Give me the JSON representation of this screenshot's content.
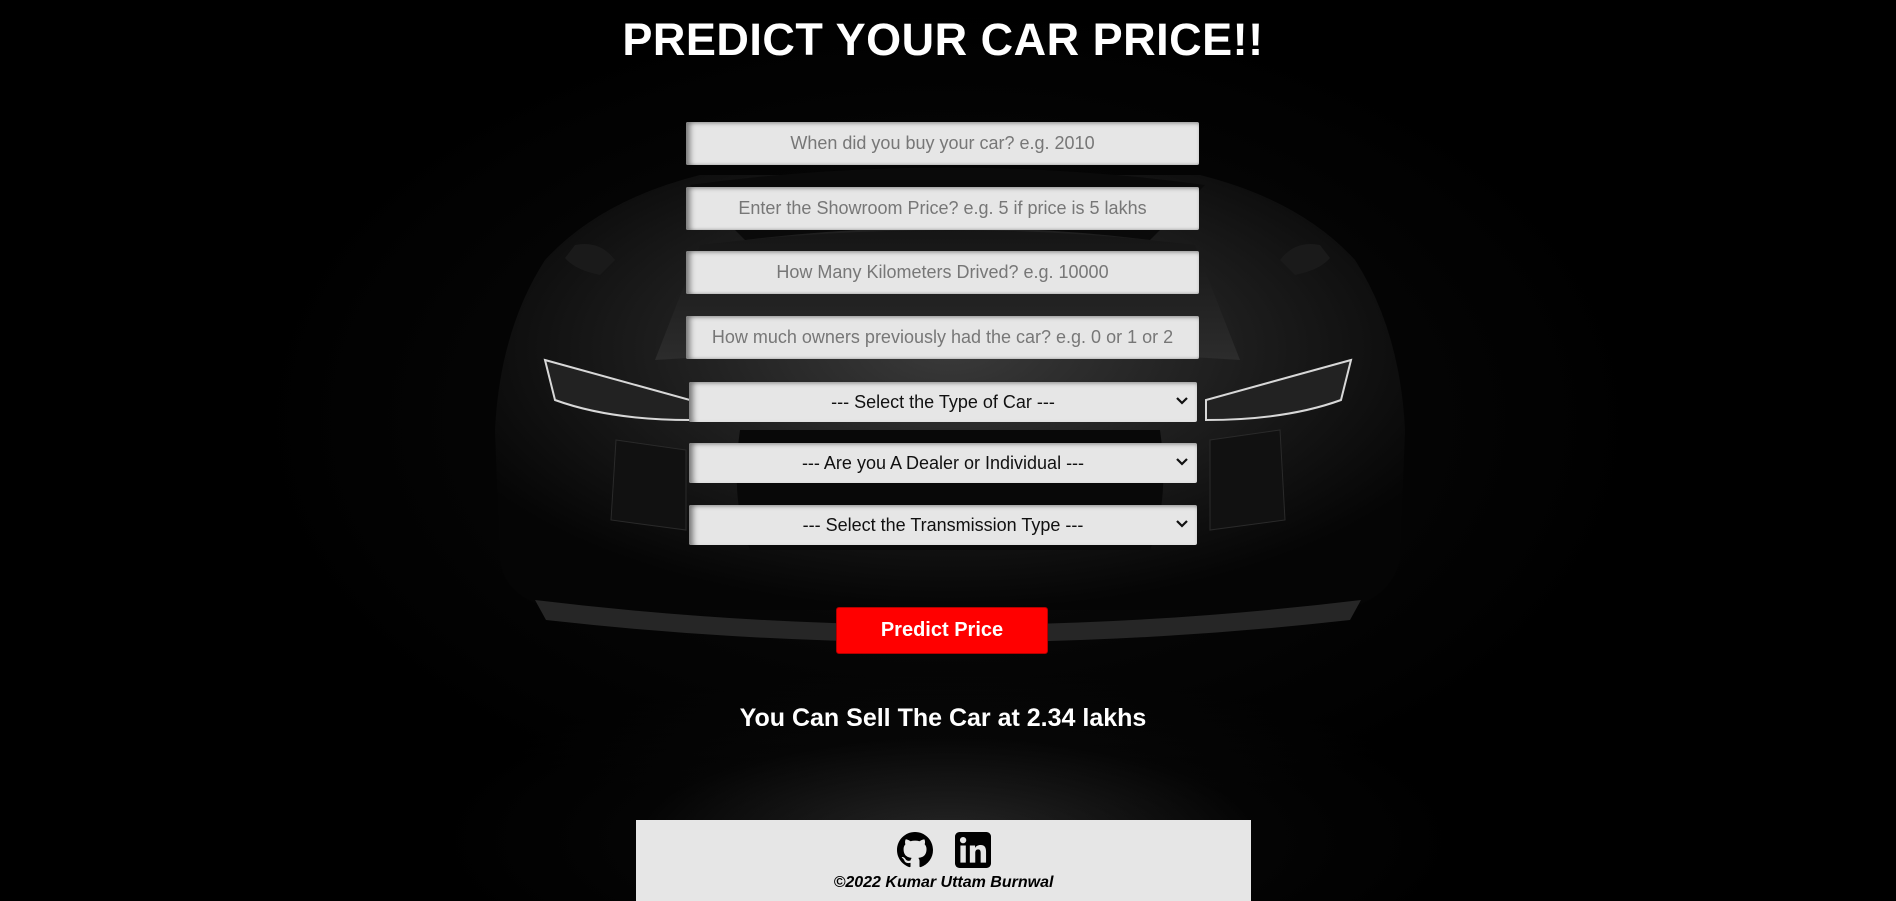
{
  "page": {
    "title": "PREDICT YOUR CAR PRICE!!"
  },
  "form": {
    "year_placeholder": "When did you buy your car? e.g. 2010",
    "showroom_price_placeholder": "Enter the Showroom Price? e.g. 5 if price is 5 lakhs",
    "kms_placeholder": "How Many Kilometers Drived? e.g. 10000",
    "owners_placeholder": "How much owners previously had the car? e.g. 0 or 1 or 2",
    "fuel_type_selected": "--- Select the Type of Car ---",
    "seller_type_selected": "--- Are you A Dealer or Individual ---",
    "transmission_selected": "--- Select the Transmission Type ---",
    "submit_label": "Predict Price"
  },
  "result": {
    "text": "You Can Sell The Car at 2.34 lakhs"
  },
  "footer": {
    "icons": [
      "github-icon",
      "linkedin-icon"
    ],
    "copyright": "©2022 Kumar Uttam Burnwal"
  },
  "colors": {
    "background": "#000000",
    "field_background": "#e6e6e6",
    "button": "#ff0000",
    "text_light": "#ffffff"
  }
}
